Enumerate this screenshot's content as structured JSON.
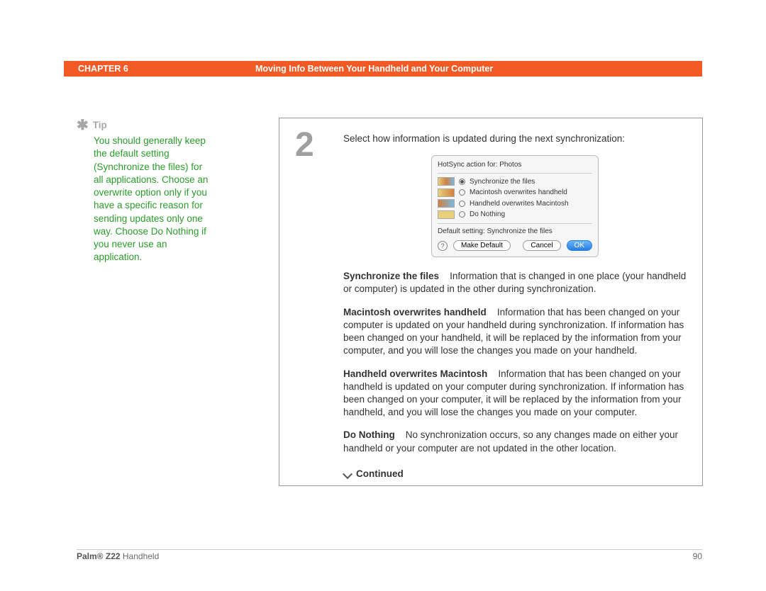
{
  "header": {
    "chapter_label": "CHAPTER 6",
    "title": "Moving Info Between Your Handheld and Your Computer"
  },
  "sidebar": {
    "tip_label": "Tip",
    "tip_body": "You should generally keep the default setting (Synchronize the files) for all applications. Choose an overwrite option only if you have a specific reason for sending updates only one way. Choose Do Nothing if you never use an application."
  },
  "step": {
    "number": "2",
    "intro": "Select how information is updated during the next synchronization:"
  },
  "dialog": {
    "title": "HotSync action for:  Photos",
    "options": [
      "Synchronize the files",
      "Macintosh overwrites handheld",
      "Handheld overwrites Macintosh",
      "Do Nothing"
    ],
    "default_label": "Default setting:  Synchronize the files",
    "buttons": {
      "make_default": "Make Default",
      "cancel": "Cancel",
      "ok": "OK"
    },
    "help": "?"
  },
  "descriptions": [
    {
      "term": "Synchronize the files",
      "text": "Information that is changed in one place (your handheld or computer) is updated in the other during synchronization."
    },
    {
      "term": "Macintosh overwrites handheld",
      "text": "Information that has been changed on your computer is updated on your handheld during synchronization. If information has been changed on your handheld, it will be replaced by the information from your computer, and you will lose the changes you made on your handheld."
    },
    {
      "term": "Handheld overwrites Macintosh",
      "text": "Information that has been changed on your handheld is updated on your computer during synchronization. If information has been changed on your computer, it will be replaced by the information from your handheld, and you will lose the changes you made on your computer."
    },
    {
      "term": "Do Nothing",
      "text": "No synchronization occurs, so any changes made on either your handheld or your computer are not updated in the other location."
    }
  ],
  "continued_label": "Continued",
  "footer": {
    "product_bold": "Palm® Z22",
    "product_rest": " Handheld",
    "page": "90"
  }
}
